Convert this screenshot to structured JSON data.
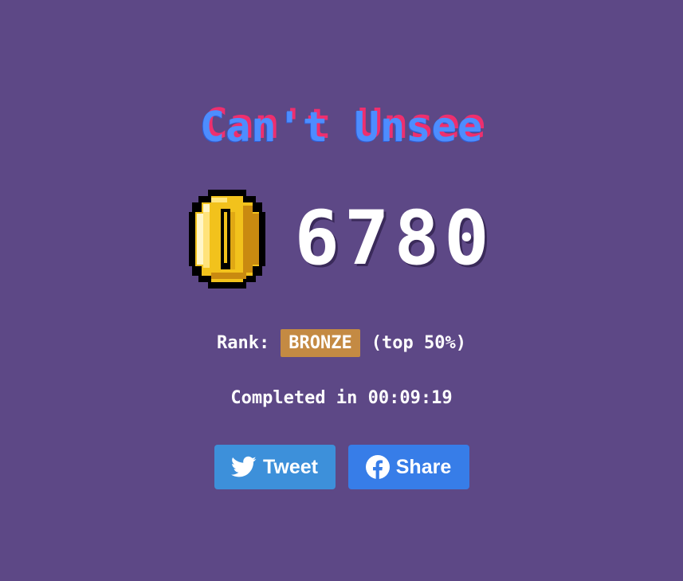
{
  "game": {
    "title": "Can't Unsee",
    "score": "6780",
    "rank_label": "Rank:",
    "rank_value": "BRONZE",
    "rank_percent": "(top 50%)",
    "completed_text": "Completed in 00:09:19"
  },
  "share": {
    "tweet_label": "Tweet",
    "share_label": "Share"
  },
  "icons": {
    "coin": "coin-icon",
    "twitter": "twitter-bird-icon",
    "facebook": "facebook-icon"
  },
  "colors": {
    "background": "#5d4886",
    "title_blue": "#4d8dff",
    "title_shadow_pink": "#ee2f6e",
    "badge_bronze": "#c48a43",
    "tweet_button": "#3d90da",
    "share_button": "#377de8"
  }
}
